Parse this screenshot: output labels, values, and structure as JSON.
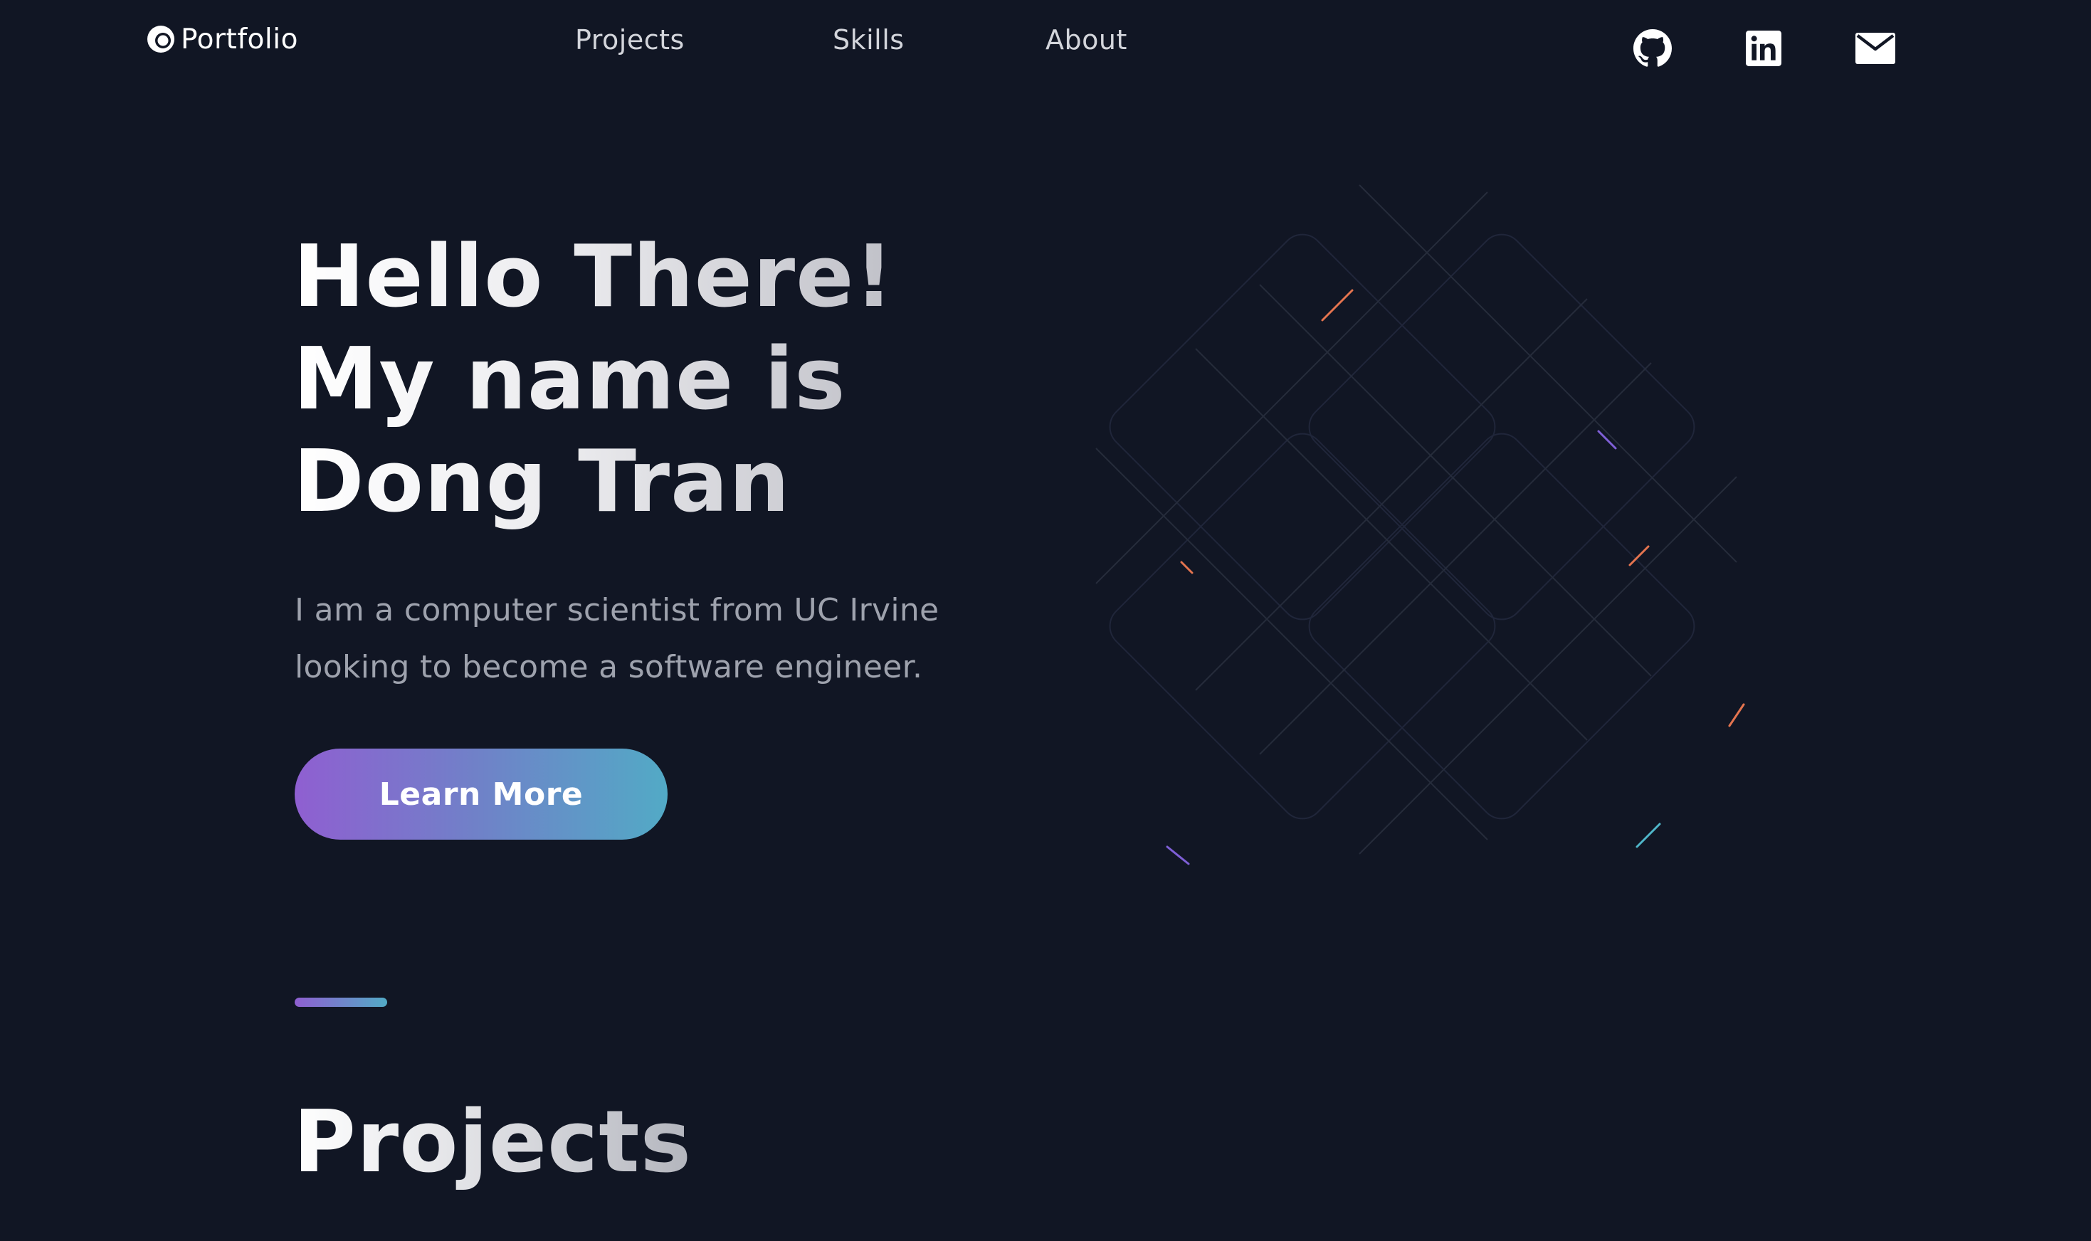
{
  "nav": {
    "brand_label": "Portfolio",
    "brand_icon": "logo-icon",
    "links": [
      {
        "label": "Projects"
      },
      {
        "label": "Skills"
      },
      {
        "label": "About"
      }
    ],
    "social": [
      {
        "icon": "github-icon"
      },
      {
        "icon": "linkedin-icon"
      },
      {
        "icon": "mail-icon"
      }
    ]
  },
  "hero": {
    "title_lines": [
      "Hello There!",
      "My name is",
      "Dong Tran"
    ],
    "subtitle_lines": [
      "I am a computer scientist from UC Irvine",
      "looking to become a software engineer."
    ],
    "cta_label": "Learn More"
  },
  "projects_section": {
    "title": "Projects"
  },
  "colors": {
    "background": "#111624",
    "gradient_start": "#8f5fd1",
    "gradient_end": "#52aac6",
    "nav_text": "#d3d5db",
    "body_text": "#9ea2ad"
  }
}
